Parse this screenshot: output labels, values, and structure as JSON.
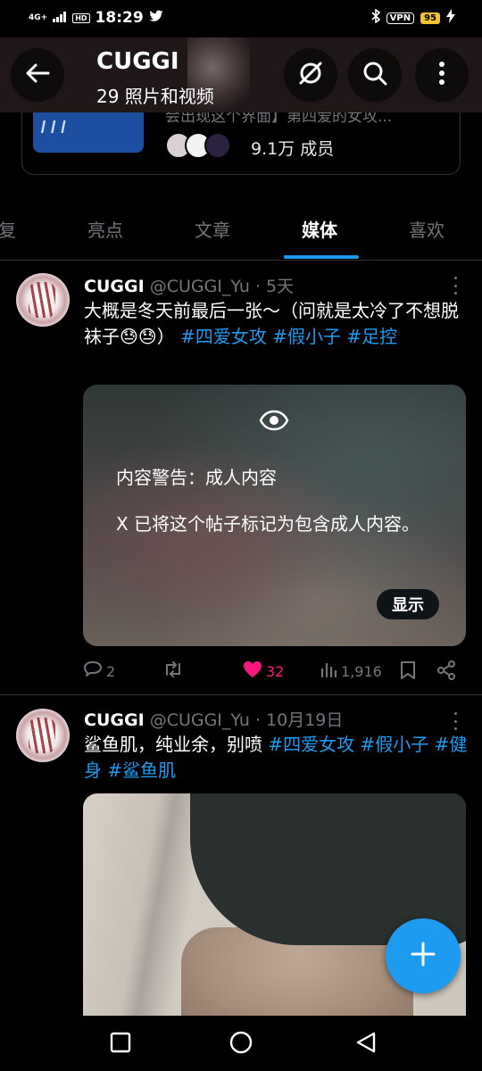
{
  "status_bar": {
    "network": "4G+",
    "hd": "HD",
    "time": "18:29",
    "vpn": "VPN",
    "battery": "95"
  },
  "header": {
    "title": "CUGGI",
    "subtitle": "29 照片和视频"
  },
  "community": {
    "description": "会出现这个界面】第四爱的女攻...",
    "members": "9.1万 成员"
  },
  "tabs": [
    {
      "label": "复"
    },
    {
      "label": "亮点"
    },
    {
      "label": "文章"
    },
    {
      "label": "媒体"
    },
    {
      "label": "喜欢"
    }
  ],
  "posts": [
    {
      "name": "CUGGI",
      "handle": "@CUGGI_Yu",
      "time": "· 5天",
      "text": "大概是冬天前最后一张～（问就是太冷了不想脱袜子😓😓）",
      "tags": [
        "#四爱女攻",
        "#假小子",
        "#足控"
      ],
      "warning": {
        "title": "内容警告：成人内容",
        "text": "X 已将这个帖子标记为包含成人内容。",
        "button": "显示"
      },
      "replies": "2",
      "likes": "32",
      "views": "1,916"
    },
    {
      "name": "CUGGI",
      "handle": "@CUGGI_Yu",
      "time": "· 10月19日",
      "text": "鲨鱼肌，纯业余，别喷",
      "tags": [
        "#四爱女攻",
        "#假小子",
        "#健身",
        "#鲨鱼肌"
      ]
    }
  ],
  "colors": {
    "accent": "#1d9bf0",
    "like": "#f91880",
    "muted": "#71767b"
  }
}
